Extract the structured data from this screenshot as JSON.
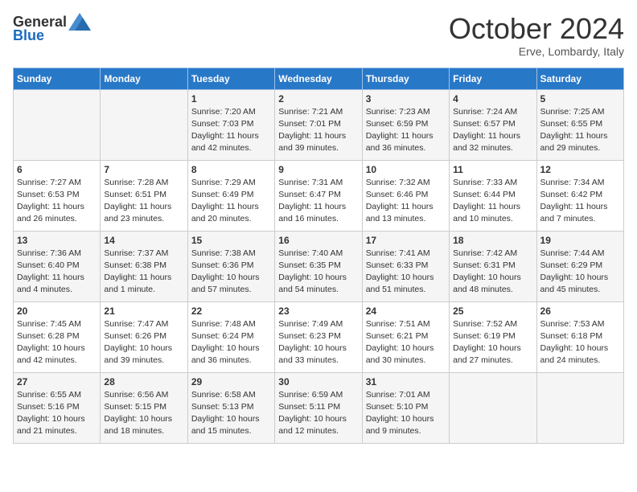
{
  "header": {
    "logo_general": "General",
    "logo_blue": "Blue",
    "month_title": "October 2024",
    "location": "Erve, Lombardy, Italy"
  },
  "days_of_week": [
    "Sunday",
    "Monday",
    "Tuesday",
    "Wednesday",
    "Thursday",
    "Friday",
    "Saturday"
  ],
  "weeks": [
    [
      {
        "day": "",
        "sunrise": "",
        "sunset": "",
        "daylight": ""
      },
      {
        "day": "",
        "sunrise": "",
        "sunset": "",
        "daylight": ""
      },
      {
        "day": "1",
        "sunrise": "Sunrise: 7:20 AM",
        "sunset": "Sunset: 7:03 PM",
        "daylight": "Daylight: 11 hours and 42 minutes."
      },
      {
        "day": "2",
        "sunrise": "Sunrise: 7:21 AM",
        "sunset": "Sunset: 7:01 PM",
        "daylight": "Daylight: 11 hours and 39 minutes."
      },
      {
        "day": "3",
        "sunrise": "Sunrise: 7:23 AM",
        "sunset": "Sunset: 6:59 PM",
        "daylight": "Daylight: 11 hours and 36 minutes."
      },
      {
        "day": "4",
        "sunrise": "Sunrise: 7:24 AM",
        "sunset": "Sunset: 6:57 PM",
        "daylight": "Daylight: 11 hours and 32 minutes."
      },
      {
        "day": "5",
        "sunrise": "Sunrise: 7:25 AM",
        "sunset": "Sunset: 6:55 PM",
        "daylight": "Daylight: 11 hours and 29 minutes."
      }
    ],
    [
      {
        "day": "6",
        "sunrise": "Sunrise: 7:27 AM",
        "sunset": "Sunset: 6:53 PM",
        "daylight": "Daylight: 11 hours and 26 minutes."
      },
      {
        "day": "7",
        "sunrise": "Sunrise: 7:28 AM",
        "sunset": "Sunset: 6:51 PM",
        "daylight": "Daylight: 11 hours and 23 minutes."
      },
      {
        "day": "8",
        "sunrise": "Sunrise: 7:29 AM",
        "sunset": "Sunset: 6:49 PM",
        "daylight": "Daylight: 11 hours and 20 minutes."
      },
      {
        "day": "9",
        "sunrise": "Sunrise: 7:31 AM",
        "sunset": "Sunset: 6:47 PM",
        "daylight": "Daylight: 11 hours and 16 minutes."
      },
      {
        "day": "10",
        "sunrise": "Sunrise: 7:32 AM",
        "sunset": "Sunset: 6:46 PM",
        "daylight": "Daylight: 11 hours and 13 minutes."
      },
      {
        "day": "11",
        "sunrise": "Sunrise: 7:33 AM",
        "sunset": "Sunset: 6:44 PM",
        "daylight": "Daylight: 11 hours and 10 minutes."
      },
      {
        "day": "12",
        "sunrise": "Sunrise: 7:34 AM",
        "sunset": "Sunset: 6:42 PM",
        "daylight": "Daylight: 11 hours and 7 minutes."
      }
    ],
    [
      {
        "day": "13",
        "sunrise": "Sunrise: 7:36 AM",
        "sunset": "Sunset: 6:40 PM",
        "daylight": "Daylight: 11 hours and 4 minutes."
      },
      {
        "day": "14",
        "sunrise": "Sunrise: 7:37 AM",
        "sunset": "Sunset: 6:38 PM",
        "daylight": "Daylight: 11 hours and 1 minute."
      },
      {
        "day": "15",
        "sunrise": "Sunrise: 7:38 AM",
        "sunset": "Sunset: 6:36 PM",
        "daylight": "Daylight: 10 hours and 57 minutes."
      },
      {
        "day": "16",
        "sunrise": "Sunrise: 7:40 AM",
        "sunset": "Sunset: 6:35 PM",
        "daylight": "Daylight: 10 hours and 54 minutes."
      },
      {
        "day": "17",
        "sunrise": "Sunrise: 7:41 AM",
        "sunset": "Sunset: 6:33 PM",
        "daylight": "Daylight: 10 hours and 51 minutes."
      },
      {
        "day": "18",
        "sunrise": "Sunrise: 7:42 AM",
        "sunset": "Sunset: 6:31 PM",
        "daylight": "Daylight: 10 hours and 48 minutes."
      },
      {
        "day": "19",
        "sunrise": "Sunrise: 7:44 AM",
        "sunset": "Sunset: 6:29 PM",
        "daylight": "Daylight: 10 hours and 45 minutes."
      }
    ],
    [
      {
        "day": "20",
        "sunrise": "Sunrise: 7:45 AM",
        "sunset": "Sunset: 6:28 PM",
        "daylight": "Daylight: 10 hours and 42 minutes."
      },
      {
        "day": "21",
        "sunrise": "Sunrise: 7:47 AM",
        "sunset": "Sunset: 6:26 PM",
        "daylight": "Daylight: 10 hours and 39 minutes."
      },
      {
        "day": "22",
        "sunrise": "Sunrise: 7:48 AM",
        "sunset": "Sunset: 6:24 PM",
        "daylight": "Daylight: 10 hours and 36 minutes."
      },
      {
        "day": "23",
        "sunrise": "Sunrise: 7:49 AM",
        "sunset": "Sunset: 6:23 PM",
        "daylight": "Daylight: 10 hours and 33 minutes."
      },
      {
        "day": "24",
        "sunrise": "Sunrise: 7:51 AM",
        "sunset": "Sunset: 6:21 PM",
        "daylight": "Daylight: 10 hours and 30 minutes."
      },
      {
        "day": "25",
        "sunrise": "Sunrise: 7:52 AM",
        "sunset": "Sunset: 6:19 PM",
        "daylight": "Daylight: 10 hours and 27 minutes."
      },
      {
        "day": "26",
        "sunrise": "Sunrise: 7:53 AM",
        "sunset": "Sunset: 6:18 PM",
        "daylight": "Daylight: 10 hours and 24 minutes."
      }
    ],
    [
      {
        "day": "27",
        "sunrise": "Sunrise: 6:55 AM",
        "sunset": "Sunset: 5:16 PM",
        "daylight": "Daylight: 10 hours and 21 minutes."
      },
      {
        "day": "28",
        "sunrise": "Sunrise: 6:56 AM",
        "sunset": "Sunset: 5:15 PM",
        "daylight": "Daylight: 10 hours and 18 minutes."
      },
      {
        "day": "29",
        "sunrise": "Sunrise: 6:58 AM",
        "sunset": "Sunset: 5:13 PM",
        "daylight": "Daylight: 10 hours and 15 minutes."
      },
      {
        "day": "30",
        "sunrise": "Sunrise: 6:59 AM",
        "sunset": "Sunset: 5:11 PM",
        "daylight": "Daylight: 10 hours and 12 minutes."
      },
      {
        "day": "31",
        "sunrise": "Sunrise: 7:01 AM",
        "sunset": "Sunset: 5:10 PM",
        "daylight": "Daylight: 10 hours and 9 minutes."
      },
      {
        "day": "",
        "sunrise": "",
        "sunset": "",
        "daylight": ""
      },
      {
        "day": "",
        "sunrise": "",
        "sunset": "",
        "daylight": ""
      }
    ]
  ]
}
